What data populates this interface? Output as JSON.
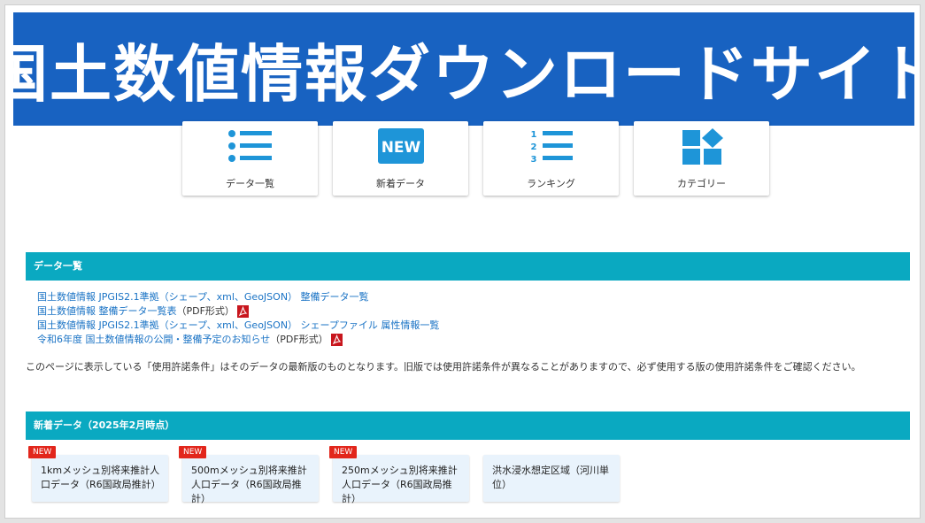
{
  "banner": {
    "title": "国土数値情報ダウンロードサイト",
    "bg_color": "#1862c1"
  },
  "nav": {
    "items": [
      {
        "label": "データ一覧",
        "icon": "list-icon"
      },
      {
        "label": "新着データ",
        "icon": "new-icon",
        "icon_text": "NEW"
      },
      {
        "label": "ランキング",
        "icon": "ranking-list-icon",
        "icon_text": "1 2 3"
      },
      {
        "label": "カテゴリー",
        "icon": "category-grid-icon"
      }
    ]
  },
  "data_list": {
    "heading": "データ一覧",
    "links": [
      {
        "text": "国土数値情報 JPGIS2.1準拠（シェープ、xml、GeoJSON） 整備データ一覧",
        "suffix": "",
        "pdf": false
      },
      {
        "text": "国土数値情報 整備データ一覧表",
        "suffix": "（PDF形式）",
        "pdf": true
      },
      {
        "text": "国土数値情報 JPGIS2.1準拠（シェープ、xml、GeoJSON） シェープファイル 属性情報一覧",
        "suffix": "",
        "pdf": false
      },
      {
        "text": "令和6年度 国土数値情報の公開・整備予定のお知らせ",
        "suffix": "（PDF形式）",
        "pdf": true
      }
    ],
    "notice": "このページに表示している「使用許諾条件」はそのデータの最新版のものとなります。旧版では使用許諾条件が異なることがありますので、必ず使用する版の使用許諾条件をご確認ください。"
  },
  "new_data": {
    "heading": "新着データ（2025年2月時点）",
    "badge_label": "NEW",
    "cards": [
      {
        "title": "1kmメッシュ別将来推計人口データ（R6国政局推計）",
        "new": true
      },
      {
        "title": "500mメッシュ別将来推計人口データ（R6国政局推計）",
        "new": true
      },
      {
        "title": "250mメッシュ別将来推計人口データ（R6国政局推計）",
        "new": true
      },
      {
        "title": "洪水浸水想定区域（河川単位）",
        "new": false
      }
    ]
  },
  "colors": {
    "accent": "#1e95d8",
    "section_bar": "#0aa9c1",
    "link": "#1a73c5",
    "badge": "#e2261c"
  }
}
